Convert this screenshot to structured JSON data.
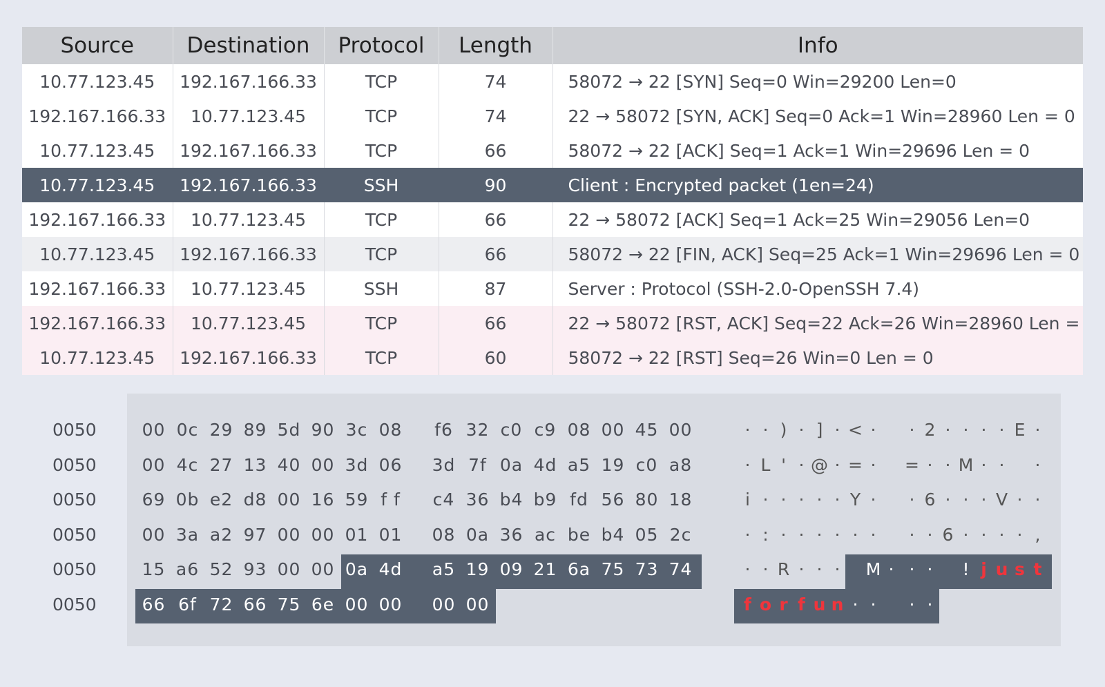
{
  "table": {
    "headers": [
      "Source",
      "Destination",
      "Protocol",
      "Length",
      "Info"
    ],
    "rows": [
      {
        "source": "10.77.123.45",
        "destination": "192.167.166.33",
        "protocol": "TCP",
        "length": "74",
        "info": "58072 → 22 [SYN] Seq=0  Win=29200  Len=0",
        "style": "white"
      },
      {
        "source": "192.167.166.33",
        "destination": "10.77.123.45",
        "protocol": "TCP",
        "length": "74",
        "info": "22 → 58072 [SYN, ACK] Seq=0  Ack=1  Win=28960  Len = 0",
        "style": "white"
      },
      {
        "source": "10.77.123.45",
        "destination": "192.167.166.33",
        "protocol": "TCP",
        "length": "66",
        "info": "58072 → 22 [ACK] Seq=1  Ack=1  Win=29696  Len = 0",
        "style": "white"
      },
      {
        "source": "10.77.123.45",
        "destination": "192.167.166.33",
        "protocol": "SSH",
        "length": "90",
        "info": "Client :  Encrypted packet (1en=24)",
        "style": "selected"
      },
      {
        "source": "192.167.166.33",
        "destination": "10.77.123.45",
        "protocol": "TCP",
        "length": "66",
        "info": "22 → 58072 [ACK] Seq=1  Ack=25  Win=29056  Len=0",
        "style": "white"
      },
      {
        "source": "10.77.123.45",
        "destination": "192.167.166.33",
        "protocol": "TCP",
        "length": "66",
        "info": "58072 → 22 [FIN, ACK] Seq=25  Ack=1  Win=29696  Len = 0",
        "style": "grey"
      },
      {
        "source": "192.167.166.33",
        "destination": "10.77.123.45",
        "protocol": "SSH",
        "length": "87",
        "info": "Server : Protocol (SSH-2.0-OpenSSH 7.4)",
        "style": "white"
      },
      {
        "source": "192.167.166.33",
        "destination": "10.77.123.45",
        "protocol": "TCP",
        "length": "66",
        "info": "22 → 58072 [RST, ACK] Seq=22  Ack=26  Win=28960  Len = 0",
        "style": "pink"
      },
      {
        "source": "10.77.123.45",
        "destination": "192.167.166.33",
        "protocol": "TCP",
        "length": "60",
        "info": "58072 → 22 [RST] Seq=26  Win=0  Len = 0",
        "style": "pink"
      }
    ]
  },
  "hex": {
    "rows": [
      {
        "offset": "0050",
        "bytes": [
          "00",
          "0c",
          "29",
          "89",
          "5d",
          "90",
          "3c",
          "08",
          "f6",
          "32",
          "c0",
          "c9",
          "08",
          "00",
          "45",
          "00"
        ],
        "ascii": [
          "·",
          "·",
          ")",
          "·",
          "]",
          "·",
          "<",
          "·",
          "",
          "·",
          "2",
          "·",
          "·",
          "·",
          "·",
          "E",
          "·"
        ]
      },
      {
        "offset": "0050",
        "bytes": [
          "00",
          "4c",
          "27",
          "13",
          "40",
          "00",
          "3d",
          "06",
          "3d",
          "7f",
          "0a",
          "4d",
          "a5",
          "19",
          "c0",
          "a8"
        ],
        "ascii": [
          "·",
          "L",
          "'",
          "·",
          "@",
          "·",
          "=",
          "·",
          "",
          "=",
          "·",
          "·",
          "M",
          "·",
          "·",
          "·"
        ]
      },
      {
        "offset": "0050",
        "bytes": [
          "69",
          "0b",
          "e2",
          "d8",
          "00",
          "16",
          "59",
          "f f",
          "c4",
          "36",
          "b4",
          "b9",
          "fd",
          "56",
          "80",
          "18"
        ],
        "ascii": [
          "i",
          "·",
          "·",
          "·",
          "·",
          "·",
          "Y",
          "·",
          "",
          "·",
          "6",
          "·",
          "·",
          "·",
          "V",
          "·",
          "·"
        ]
      },
      {
        "offset": "0050",
        "bytes": [
          "00",
          "3a",
          "a2",
          "97",
          "00",
          "00",
          "01",
          "01",
          "08",
          "0a",
          "36",
          "ac",
          "be",
          "b4",
          "05",
          "2c"
        ],
        "ascii": [
          "·",
          ":",
          "·",
          "·",
          "·",
          "·",
          "·",
          "·",
          "",
          "·",
          "·",
          "6",
          "·",
          "·",
          "·",
          "·",
          ","
        ]
      },
      {
        "offset": "0050",
        "bytes": [
          "15",
          "a6",
          "52",
          "93",
          "00",
          "00",
          "0a",
          "4d",
          "a5",
          "19",
          "09",
          "21",
          "6a",
          "75",
          "73",
          "74"
        ],
        "ascii": [
          "·",
          "·",
          "R",
          "·",
          "·",
          "·",
          "M",
          "·",
          "",
          "·",
          "·",
          "!",
          "j",
          "u",
          "s",
          "t"
        ]
      },
      {
        "offset": "0050",
        "bytes": [
          "66",
          "6f",
          "72",
          "66",
          "75",
          "6e",
          "00",
          "00",
          "00",
          "00"
        ],
        "ascii": [
          "f",
          "o",
          "r",
          "f",
          "u",
          "n",
          "·",
          "·",
          "",
          "·",
          "·"
        ]
      }
    ]
  }
}
